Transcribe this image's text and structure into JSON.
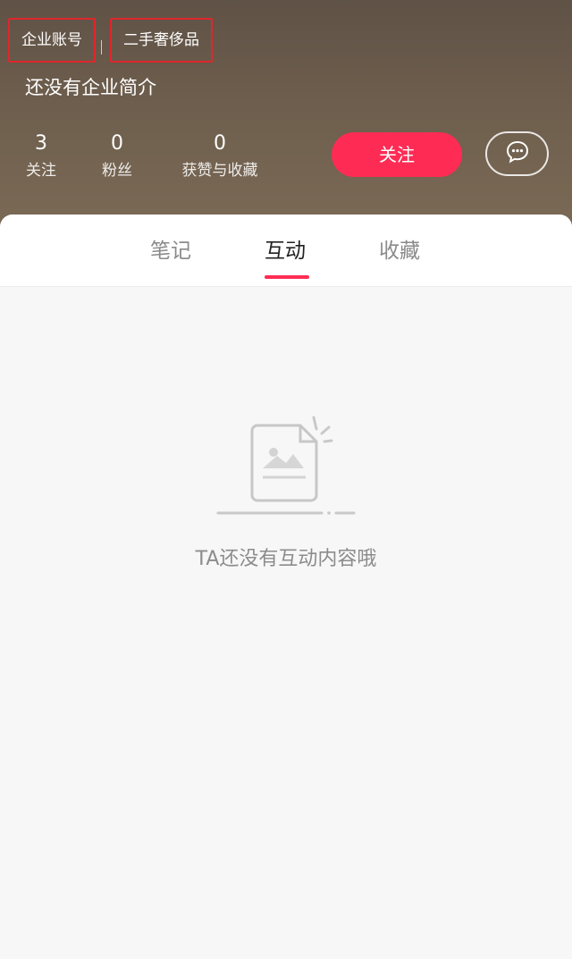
{
  "profile": {
    "tags": [
      "企业账号",
      "二手奢侈品"
    ],
    "bio": "还没有企业简介",
    "stats": [
      {
        "value": "3",
        "label": "关注"
      },
      {
        "value": "0",
        "label": "粉丝"
      },
      {
        "value": "0",
        "label": "获赞与收藏"
      }
    ],
    "follow_label": "关注",
    "message_icon": "chat-bubble-icon"
  },
  "tabs": [
    {
      "label": "笔记"
    },
    {
      "label": "互动"
    },
    {
      "label": "收藏"
    }
  ],
  "active_tab": "互动",
  "empty_state": {
    "icon": "empty-document-icon",
    "text": "TA还没有互动内容哦"
  },
  "colors": {
    "accent": "#fe2c55",
    "annotation_box": "#e0262c",
    "header_bg": "#6e5e4d"
  }
}
